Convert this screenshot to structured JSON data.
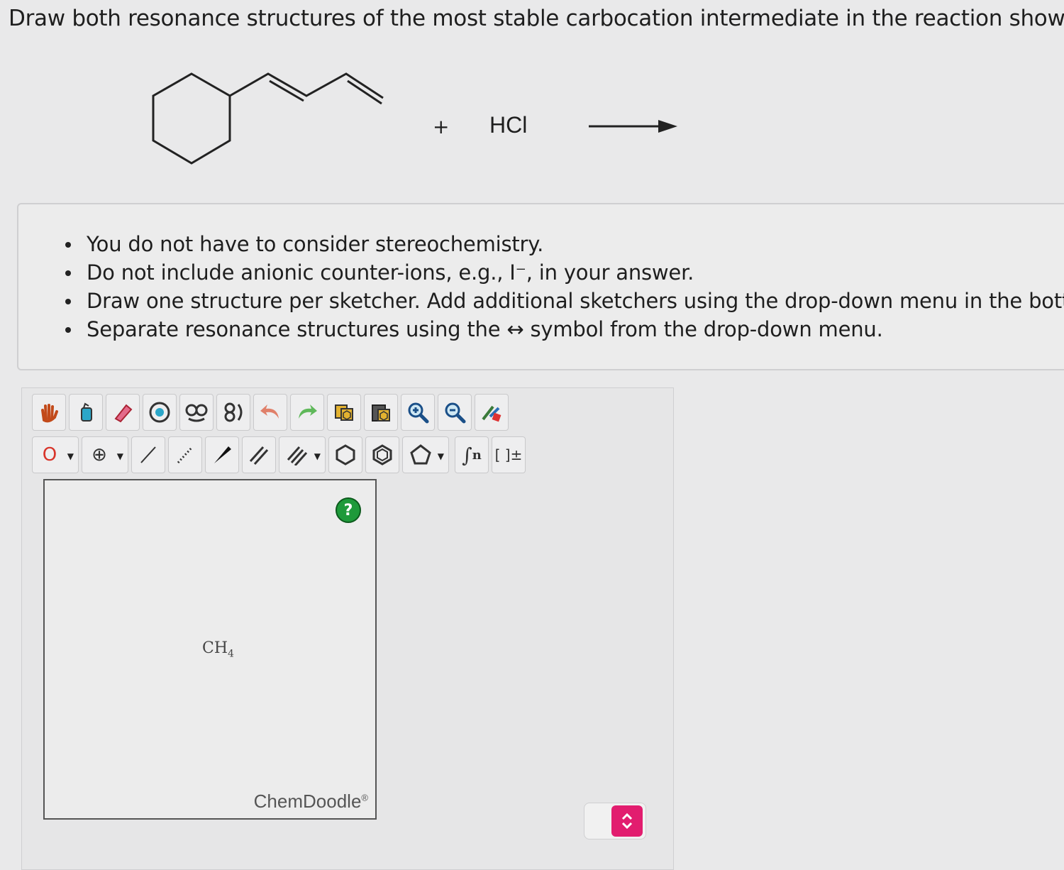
{
  "question": "Draw both resonance structures of the most stable carbocation intermediate in the reaction shown.",
  "reaction": {
    "plus": "+",
    "reagent": "HCl"
  },
  "instructions": [
    "You do not have to consider stereochemistry.",
    "Do not include anionic counter-ions, e.g., I⁻, in your answer.",
    "Draw one structure per sketcher. Add additional sketchers using the drop-down menu in the bott",
    "Separate resonance structures using the ↔ symbol from the drop-down menu."
  ],
  "toolbar": {
    "row1": [
      "hand-icon",
      "lasso-icon",
      "eraser-icon",
      "ring-template-icon",
      "ring-template-2-icon",
      "ring-template-3-icon",
      "undo-icon",
      "redo-icon",
      "copy-icon",
      "paste-icon",
      "zoom-in-icon",
      "zoom-out-icon",
      "clean-icon"
    ],
    "atom_label": "O",
    "charge_label": "⊕",
    "sgroup_label": "n",
    "bracket_label": "[ ]±"
  },
  "sketcher": {
    "help_label": "?",
    "atom_main": "CH",
    "atom_sub": "4",
    "brand": "ChemDoodle",
    "brand_mark": "®"
  },
  "colors": {
    "accent": "#e21d6f",
    "help": "#1e9a3a"
  }
}
